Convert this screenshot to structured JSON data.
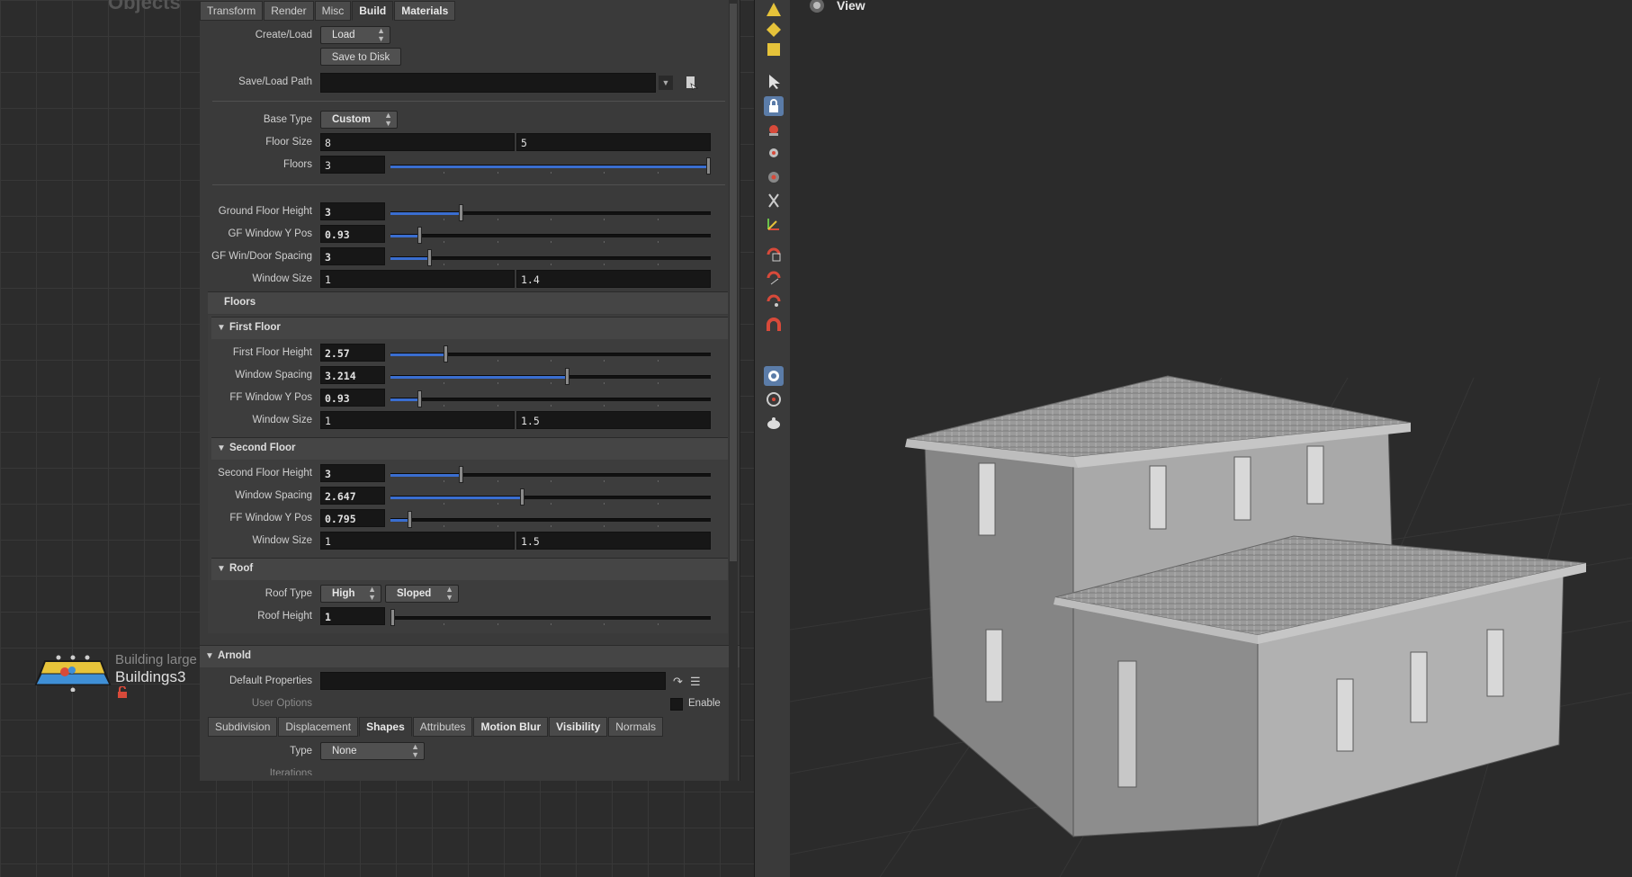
{
  "network": {
    "title": "Objects",
    "node_type": "Building large",
    "node_name": "Buildings3"
  },
  "tabs_top": [
    "Transform",
    "Render",
    "Misc",
    "Build",
    "Materials"
  ],
  "build": {
    "create_load_label": "Create/Load",
    "create_load_value": "Load",
    "save_to_disk": "Save to Disk",
    "save_load_path_label": "Save/Load Path",
    "save_load_path_value": "",
    "base_type_label": "Base Type",
    "base_type_value": "Custom",
    "floor_size_label": "Floor Size",
    "floor_size_x": "8",
    "floor_size_y": "5",
    "floors_label": "Floors",
    "floors_value": "3",
    "floors_level": 1.0,
    "ground_floor_height_label": "Ground Floor Height",
    "ground_floor_height_value": "3",
    "ground_floor_height_level": 0.22,
    "gf_window_y_label": "GF Window Y Pos",
    "gf_window_y_value": "0.93",
    "gf_window_y_level": 0.09,
    "gf_win_door_label": "GF Win/Door Spacing",
    "gf_win_door_value": "3",
    "gf_win_door_level": 0.12,
    "window_size_label": "Window Size",
    "window_size_x": "1",
    "window_size_y": "1.4"
  },
  "floors_heading": "Floors",
  "first_floor": {
    "title": "First Floor",
    "height_label": "First Floor Height",
    "height_value": "2.57",
    "height_level": 0.17,
    "spacing_label": "Window Spacing",
    "spacing_value": "3.214",
    "spacing_level": 0.55,
    "ypos_label": "FF Window Y Pos",
    "ypos_value": "0.93",
    "ypos_level": 0.09,
    "size_label": "Window Size",
    "size_x": "1",
    "size_y": "1.5"
  },
  "second_floor": {
    "title": "Second Floor",
    "height_label": "Second Floor Height",
    "height_value": "3",
    "height_level": 0.22,
    "spacing_label": "Window Spacing",
    "spacing_value": "2.647",
    "spacing_level": 0.41,
    "ypos_label": "FF Window Y Pos",
    "ypos_value": "0.795",
    "ypos_level": 0.06,
    "size_label": "Window Size",
    "size_x": "1",
    "size_y": "1.5"
  },
  "roof": {
    "title": "Roof",
    "type_label": "Roof Type",
    "type_value1": "High",
    "type_value2": "Sloped",
    "height_label": "Roof Height",
    "height_value": "1",
    "height_level": 0.0
  },
  "arnold": {
    "title": "Arnold",
    "default_props_label": "Default Properties",
    "user_options_label": "User Options",
    "enable_label": "Enable",
    "tabs": [
      "Subdivision",
      "Displacement",
      "Shapes",
      "Attributes",
      "Motion Blur",
      "Visibility",
      "Normals"
    ],
    "type_label": "Type",
    "type_value": "None",
    "iterations_label": "Iterations"
  },
  "viewport": {
    "title": "View"
  },
  "colors": {
    "accent": "#3a6ed0",
    "panel": "#3a3a3a",
    "field": "#171717"
  }
}
